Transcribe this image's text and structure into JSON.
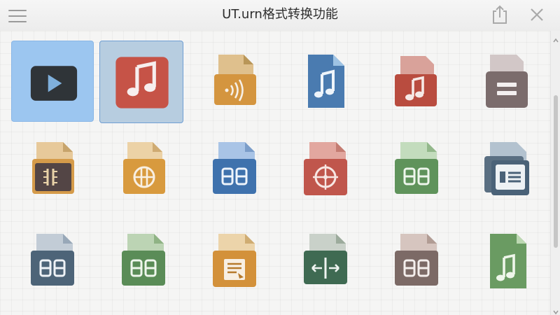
{
  "window": {
    "title": "UT.urn格式转换功能"
  },
  "toolbar": {
    "menu_icon": "hamburger-icon",
    "share_icon": "share-icon",
    "close_icon": "close-icon"
  },
  "colors": {
    "selected_primary": "#9cc6f0",
    "selected_secondary": "#b7cde0",
    "file_tan": "#d6a861",
    "file_orange": "#c98a3a",
    "file_blue": "#3e6e9e",
    "file_red": "#b84e43",
    "file_gray": "#7a6c6c",
    "file_green": "#5d8f5b",
    "file_slate": "#4a6278"
  },
  "tiles": [
    {
      "icon": "video-play-icon",
      "state": "selected"
    },
    {
      "icon": "music-note-icon",
      "state": "focused"
    },
    {
      "icon": "audio-file-icon"
    },
    {
      "icon": "music-file-icon"
    },
    {
      "icon": "music-folder-icon"
    },
    {
      "icon": "document-folder-icon"
    },
    {
      "icon": "archive-file-icon"
    },
    {
      "icon": "archive-folder-icon"
    },
    {
      "icon": "grid-file-icon"
    },
    {
      "icon": "target-file-icon"
    },
    {
      "icon": "grid-folder-icon"
    },
    {
      "icon": "stacked-files-icon"
    },
    {
      "icon": "grid-file-icon"
    },
    {
      "icon": "grid-folder-icon"
    },
    {
      "icon": "text-file-icon"
    },
    {
      "icon": "split-folder-icon"
    },
    {
      "icon": "grid-folder-icon"
    },
    {
      "icon": "music-file-icon"
    }
  ]
}
